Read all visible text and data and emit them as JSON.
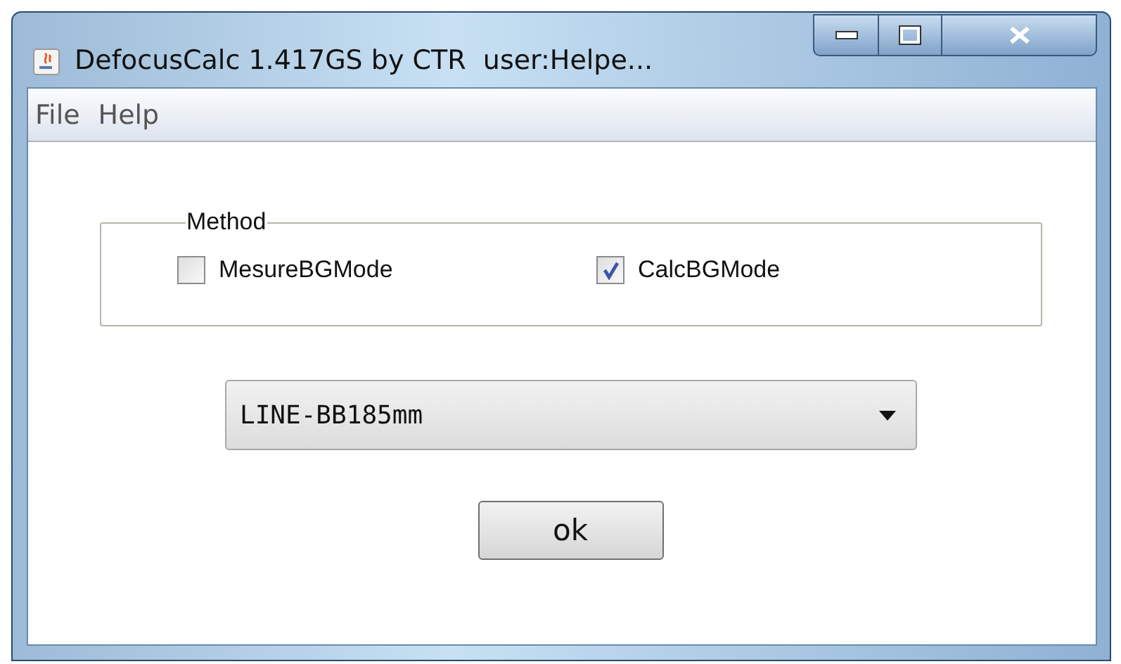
{
  "window": {
    "title": "DefocusCalc 1.417GS by CTR  user:Helpe..."
  },
  "menu": [
    {
      "label": "File"
    },
    {
      "label": "Help"
    }
  ],
  "method_group": {
    "title": "Method",
    "options": [
      {
        "label": "MesureBGMode",
        "checked": false
      },
      {
        "label": "CalcBGMode",
        "checked": true
      }
    ]
  },
  "dropdown": {
    "value": "LINE-BB185mm"
  },
  "buttons": [
    "ok"
  ]
}
